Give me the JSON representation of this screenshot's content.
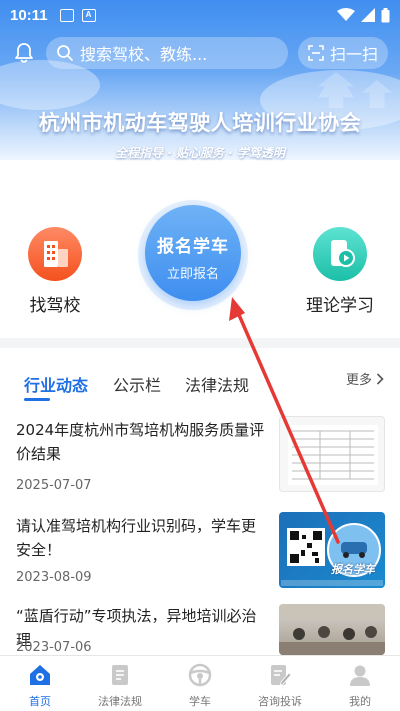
{
  "status_bar": {
    "time": "10:11"
  },
  "header": {
    "search_placeholder": "搜索驾校、教练...",
    "scan_label": "扫一扫",
    "org_title": "杭州市机动车驾驶人培训行业协会",
    "org_subtitle": "全程指导 · 贴心服务 · 学驾透明"
  },
  "quick_actions": {
    "find_school": "找驾校",
    "enroll_title": "报名学车",
    "enroll_sub": "立即报名",
    "theory": "理论学习"
  },
  "tabs": {
    "items": [
      "行业动态",
      "公示栏",
      "法律法规"
    ],
    "active": "行业动态",
    "more": "更多"
  },
  "news": [
    {
      "title": "2024年度杭州市驾培机构服务质量评价结果",
      "date": "2025-07-07"
    },
    {
      "title": "请认准驾培机构行业识别码，学车更安全！",
      "date": "2023-08-09",
      "thumb_badge": "报名学车"
    },
    {
      "title": "“蓝盾行动”专项执法，异地培训必治理",
      "date": "2023-07-06"
    }
  ],
  "bottom_nav": {
    "items": [
      "首页",
      "法律法规",
      "学车",
      "咨询投诉",
      "我的"
    ],
    "active": "首页"
  },
  "colors": {
    "primary": "#1f6fe5",
    "banner": "#3f8ef0",
    "annotation_arrow": "#e53935"
  }
}
